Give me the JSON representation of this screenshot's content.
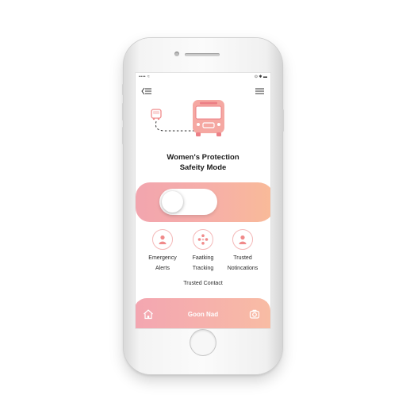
{
  "status_bar": {
    "left": "•••• ≈",
    "right": "⊙ ✱ ▬"
  },
  "header": {
    "back_icon": "back-menu-icon",
    "menu_icon": "hamburger-icon"
  },
  "hero": {
    "small_bus_icon": "small-bus-icon",
    "large_bus_icon": "large-bus-icon"
  },
  "title": {
    "line1": "Women's Protection",
    "line2": "Safeity Mode"
  },
  "safety_toggle": {
    "state": "off"
  },
  "features": [
    {
      "label_line1": "Emergency",
      "label_line2": "Alerts",
      "icon": "person-icon"
    },
    {
      "label_line1": "Faatking",
      "label_line2": "Tracking",
      "icon": "group-icon"
    },
    {
      "label_line1": "Trusted",
      "label_line2": "Notincations",
      "icon": "person-icon"
    }
  ],
  "trusted_contact": "Trusted Contact",
  "bottom_bar": {
    "label": "Goon Nad",
    "left_icon": "home-icon",
    "right_icon": "camera-icon"
  },
  "colors": {
    "accent": "#f6aea9",
    "gradient_start": "#f2a5ae",
    "gradient_end": "#f9bb98",
    "icon_pink": "#f08a8a"
  }
}
